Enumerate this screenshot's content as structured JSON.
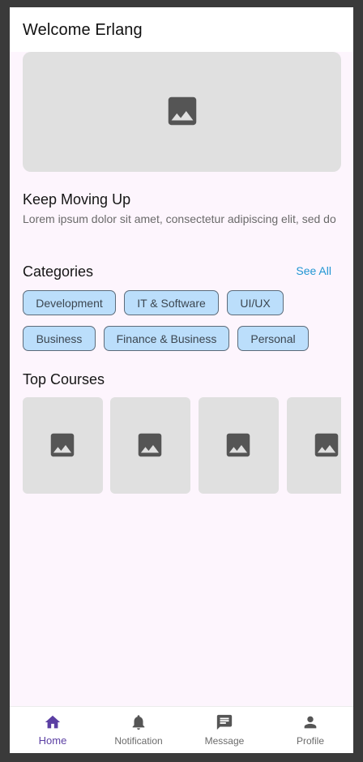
{
  "appbar": {
    "title": "Welcome Erlang"
  },
  "banner": {
    "icon": "image-placeholder-icon"
  },
  "hero": {
    "title": "Keep Moving Up",
    "description": "Lorem ipsum dolor sit amet, consectetur adipiscing elit, sed do"
  },
  "categories": {
    "title": "Categories",
    "see_all": "See All",
    "items": [
      "Development",
      "IT & Software",
      "UI/UX",
      "Business",
      "Finance & Business",
      "Personal"
    ]
  },
  "top_courses": {
    "title": "Top Courses",
    "icon": "image-placeholder-icon"
  },
  "bottom_nav": {
    "items": [
      {
        "label": "Home",
        "icon": "home-icon",
        "active": true
      },
      {
        "label": "Notification",
        "icon": "bell-icon",
        "active": false
      },
      {
        "label": "Message",
        "icon": "message-icon",
        "active": false
      },
      {
        "label": "Profile",
        "icon": "person-icon",
        "active": false
      }
    ]
  },
  "colors": {
    "background": "#fdf5fd",
    "chip_fill": "#bbdefb",
    "accent_link": "#2196d3",
    "active_nav": "#5b3fa3",
    "placeholder": "#e0e0e0",
    "placeholder_icon": "#555555"
  }
}
